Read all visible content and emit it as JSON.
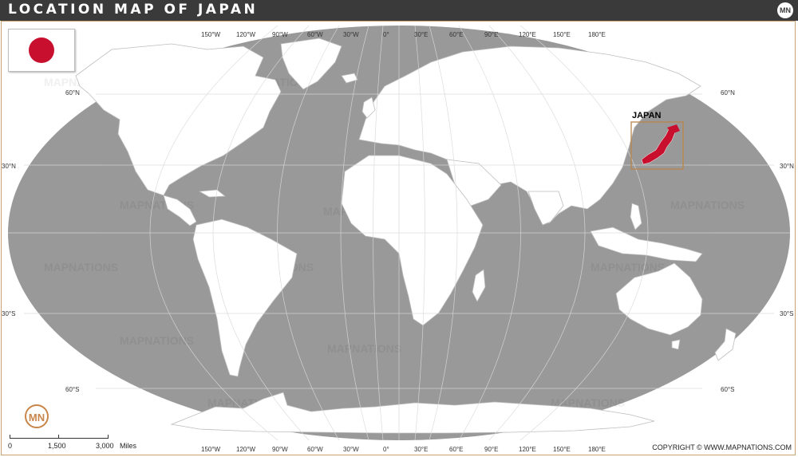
{
  "title": "LOCATION MAP OF JAPAN",
  "brand_mark": "MN",
  "country_label": "JAPAN",
  "copyright": "COPYRIGHT © WWW.MAPNATIONS.COM",
  "watermark": "MAPNATIONS",
  "colors": {
    "ocean": "#999999",
    "land": "#ffffff",
    "highlight": "#c8102e",
    "locator_box": "#b8864a",
    "titlebar": "#3a3a3a"
  },
  "longitude_labels": [
    "150°W",
    "120°W",
    "90°W",
    "60°W",
    "30°W",
    "0°",
    "30°E",
    "60°E",
    "90°E",
    "120°E",
    "150°E",
    "180°E"
  ],
  "latitude_labels": {
    "north60": "60°N",
    "north30": "30°N",
    "south30": "30°S",
    "south60": "60°S"
  },
  "scale": {
    "label0": "0",
    "label1": "1,500",
    "label2": "3,000",
    "unit": "Miles"
  },
  "flag": {
    "name": "Flag of Japan",
    "icon": "japan-flag-icon"
  }
}
